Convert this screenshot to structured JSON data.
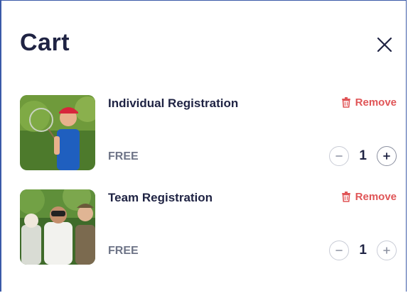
{
  "cart": {
    "title": "Cart",
    "items": [
      {
        "name": "Individual Registration",
        "remove_label": "Remove",
        "price": "FREE",
        "quantity": "1"
      },
      {
        "name": "Team Registration",
        "remove_label": "Remove",
        "price": "FREE",
        "quantity": "1"
      }
    ]
  },
  "colors": {
    "title": "#1f2343",
    "remove": "#e05557",
    "price": "#6e7487",
    "border": "#3b5aa8"
  },
  "icons": {
    "close": "close-icon",
    "remove": "trash-icon",
    "decrease": "minus-icon",
    "increase": "plus-icon"
  }
}
